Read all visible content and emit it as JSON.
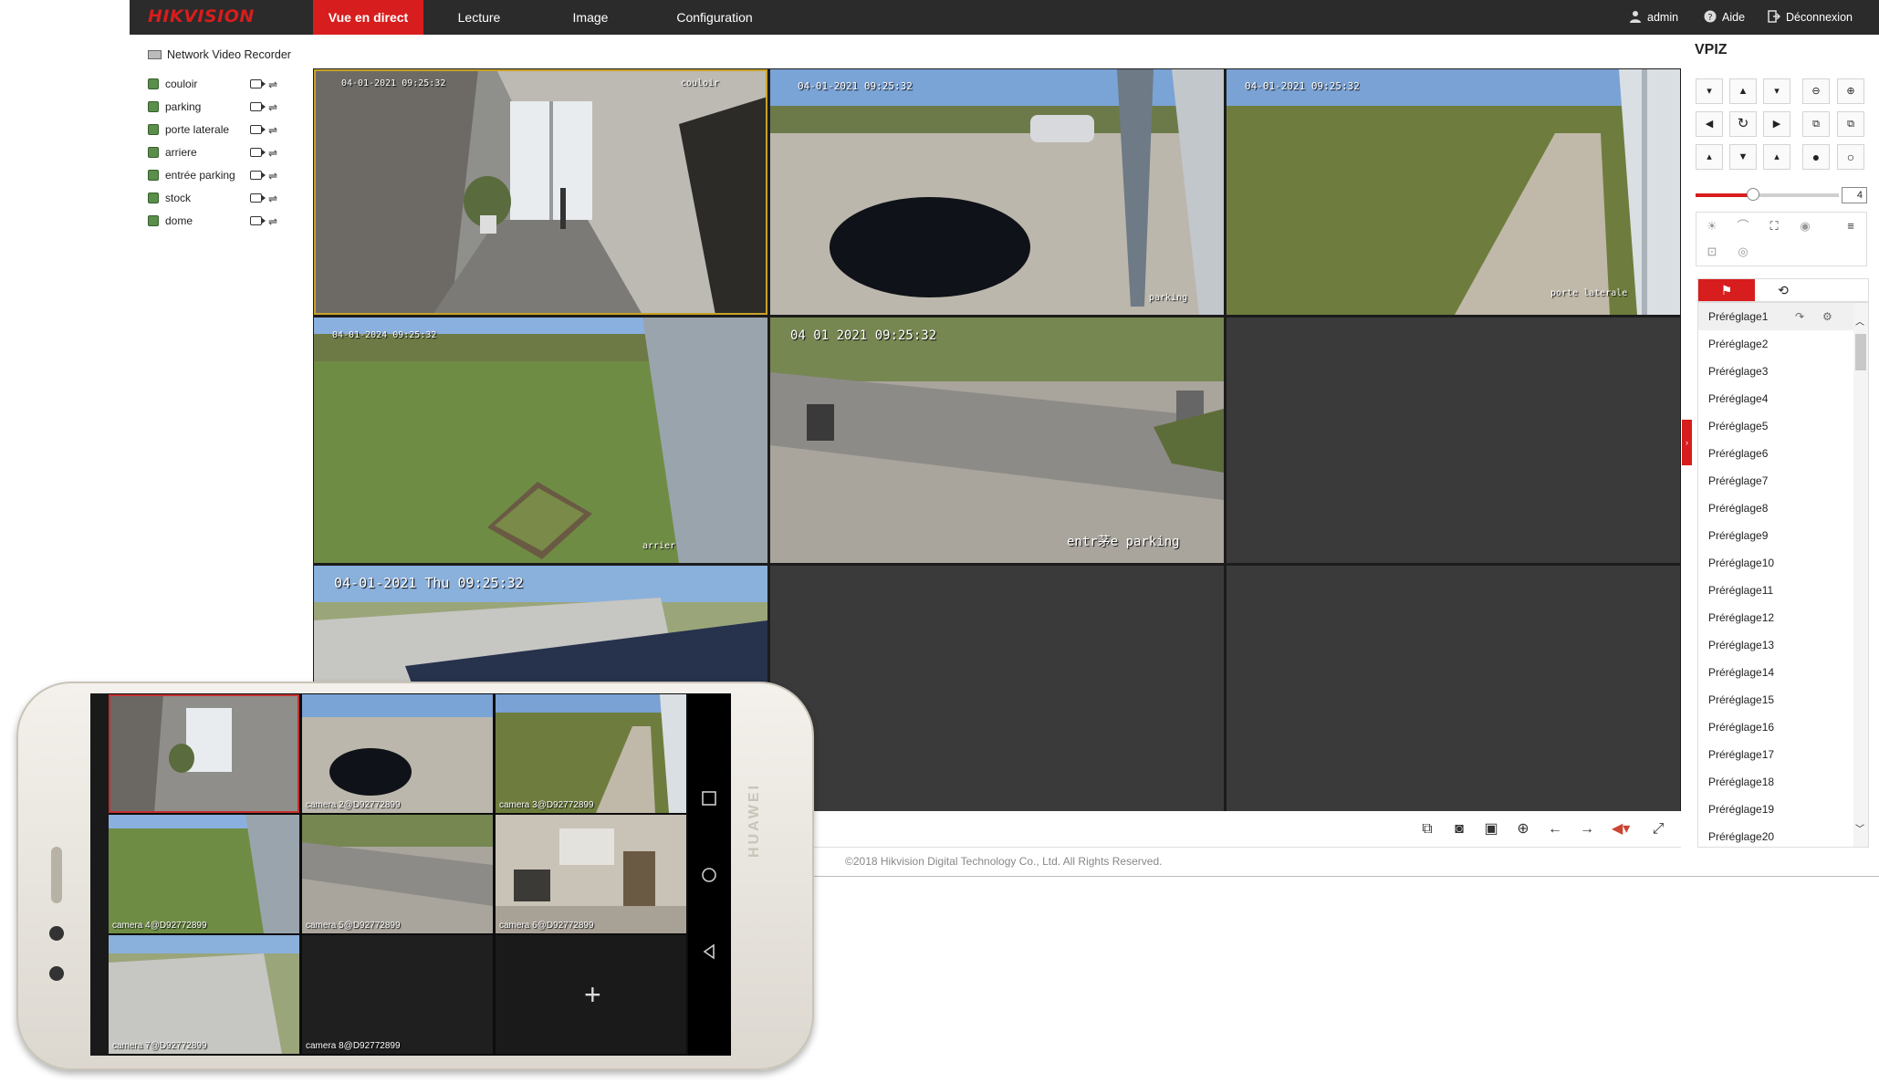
{
  "header": {
    "logo": "HIKVISION",
    "nav": [
      "Vue en direct",
      "Lecture",
      "Image",
      "Configuration"
    ],
    "active_nav": "Vue en direct",
    "user": "admin",
    "help": "Aide",
    "logout": "Déconnexion"
  },
  "sidebar": {
    "title": "Network Video Recorder",
    "cameras": [
      {
        "label": "couloir"
      },
      {
        "label": "parking"
      },
      {
        "label": "porte laterale"
      },
      {
        "label": "arriere"
      },
      {
        "label": "entrée parking"
      },
      {
        "label": "stock"
      },
      {
        "label": "dome"
      }
    ]
  },
  "grid": {
    "cells": [
      {
        "osd": "04-01-2021 09:25:32",
        "name": "couloir",
        "scene": "indoor"
      },
      {
        "osd": "04-01-2021 09:25:32",
        "name": "parking",
        "scene": "carpark"
      },
      {
        "osd": "04-01-2021 09:25:32",
        "name": "porte laterale",
        "scene": "field"
      },
      {
        "osd": "04-01-2024 09:25:32",
        "name": "arrier",
        "scene": "grass"
      },
      {
        "osd": "04 01 2021 09:25:32",
        "name": "entr茅e parking",
        "scene": "road"
      },
      {
        "osd": "",
        "name": "",
        "scene": "empty"
      },
      {
        "osd": "04-01-2021 Thu 09:25:32",
        "name": "",
        "scene": "dome"
      },
      {
        "osd": "",
        "name": "",
        "scene": "empty"
      },
      {
        "osd": "",
        "name": "",
        "scene": "empty"
      }
    ]
  },
  "ptz": {
    "title": "VPIZ",
    "zoom_value": "4",
    "zoom_level": 0.4,
    "presets": [
      "Préréglage1",
      "Préréglage2",
      "Préréglage3",
      "Préréglage4",
      "Préréglage5",
      "Préréglage6",
      "Préréglage7",
      "Préréglage8",
      "Préréglage9",
      "Préréglage10",
      "Préréglage11",
      "Préréglage12",
      "Préréglage13",
      "Préréglage14",
      "Préréglage15",
      "Préréglage16",
      "Préréglage17",
      "Préréglage18",
      "Préréglage19",
      "Préréglage20"
    ]
  },
  "footer": {
    "copyright": "©2018 Hikvision Digital Technology Co., Ltd. All Rights Reserved."
  },
  "phone": {
    "brand": "HUAWEI",
    "cells": [
      {
        "label": "",
        "scene": "indoor"
      },
      {
        "label": "camera 2@D92772899",
        "scene": "carpark"
      },
      {
        "label": "camera 3@D92772899",
        "scene": "field"
      },
      {
        "label": "camera 4@D92772899",
        "scene": "grass"
      },
      {
        "label": "camera 5@D92772899",
        "scene": "road"
      },
      {
        "label": "camera 6@D92772899",
        "scene": "office"
      },
      {
        "label": "camera 7@D92772899",
        "scene": "dome"
      },
      {
        "label": "camera 8@D92772899",
        "scene": "empty"
      },
      {
        "label": "",
        "scene": "add"
      }
    ],
    "add_symbol": "+"
  },
  "colors": {
    "brand_red": "#d71d1d",
    "topbar": "#2b2b2b",
    "selected_outline": "#c9a227"
  }
}
